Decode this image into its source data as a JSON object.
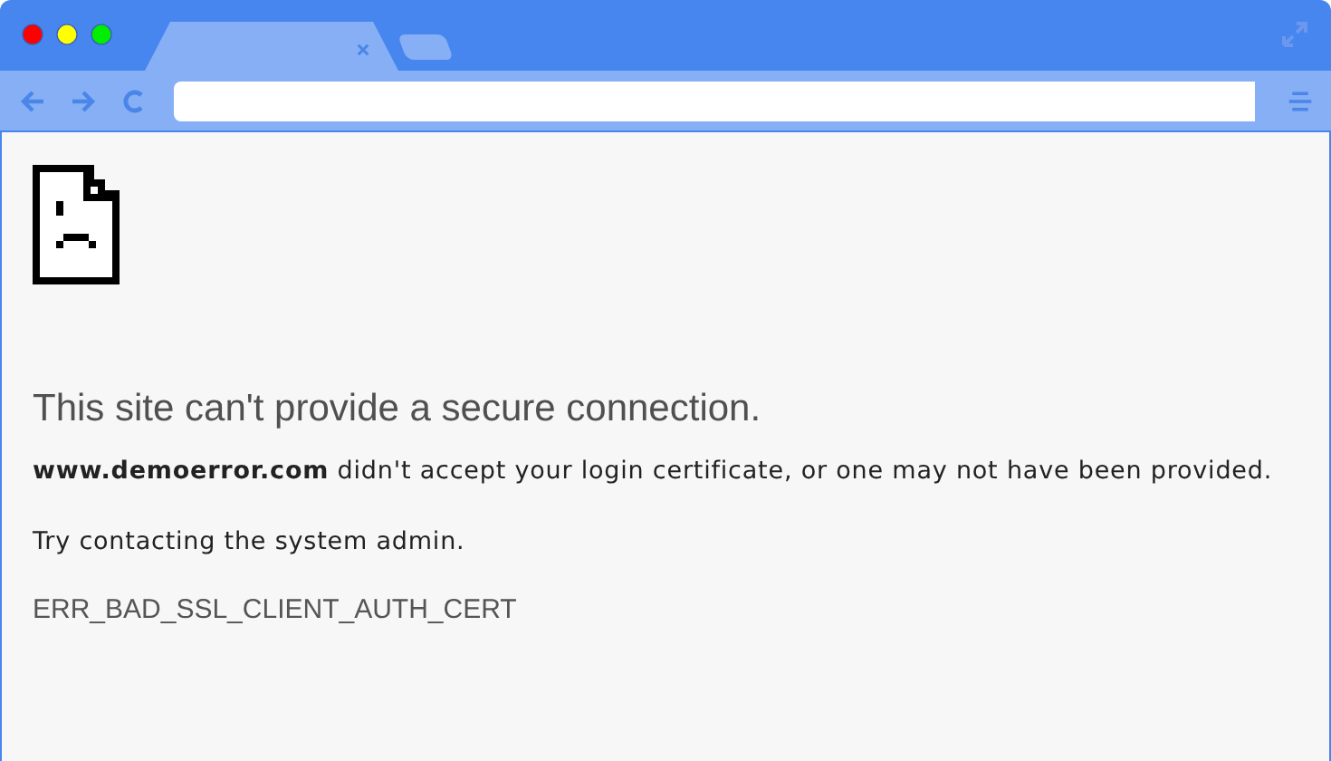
{
  "tabs": [
    {
      "selected": true
    },
    {
      "selected": false
    }
  ],
  "page": {
    "heading": "This site can't provide a secure connection.",
    "message": "**www.demoerror.com** didn't accept your login certificate, or one may not have been provided.",
    "hint": "Try contacting the system admin.",
    "error_code": "ERR_BAD_SSL_CLIENT_AUTH_CERT"
  }
}
